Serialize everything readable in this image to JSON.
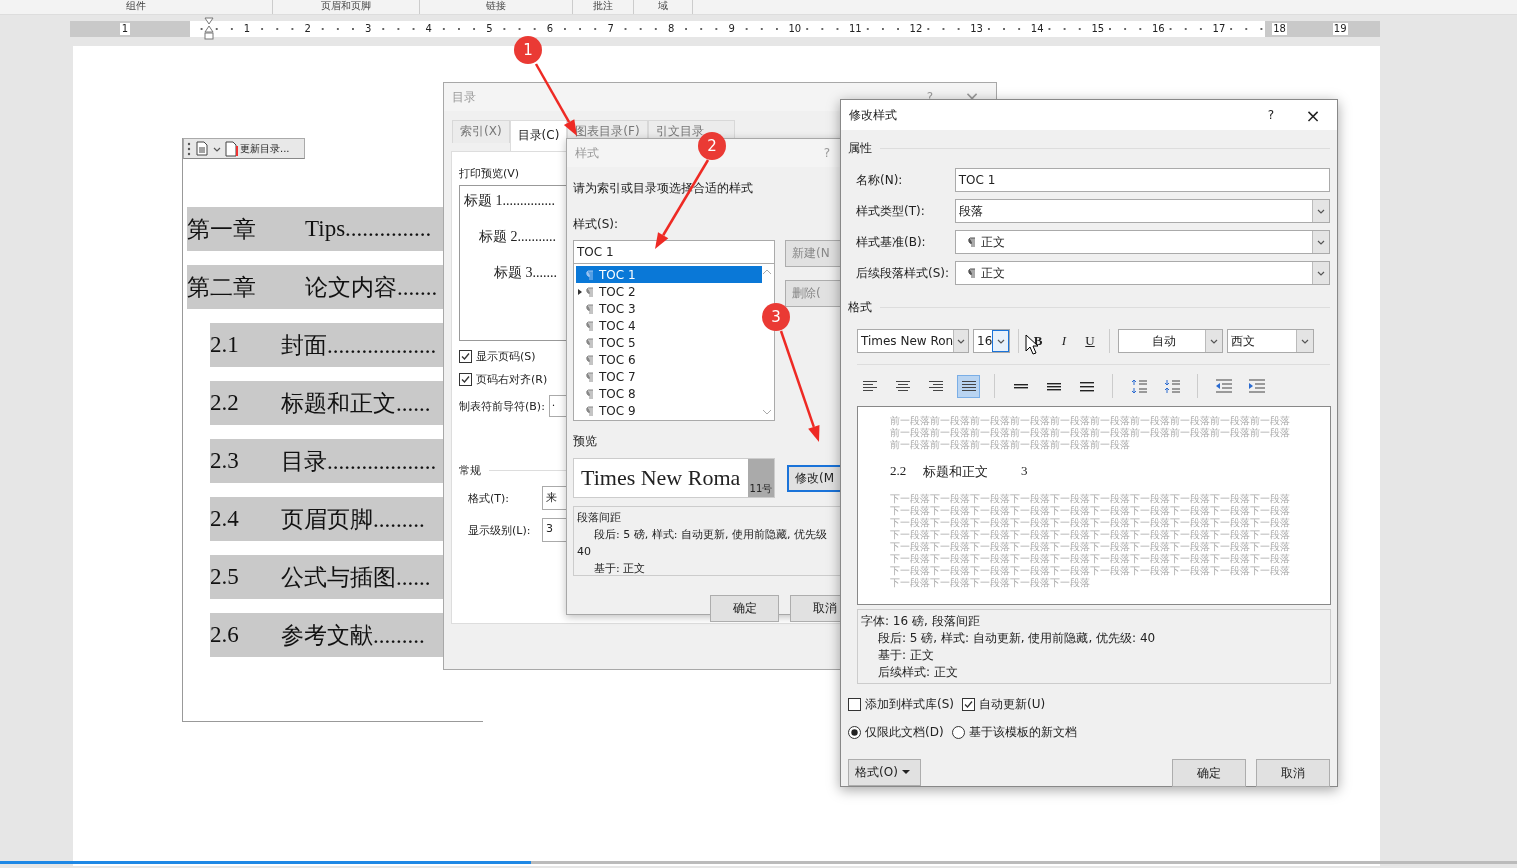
{
  "ribbon_groups": [
    "组件",
    "页眉和页脚",
    "链接",
    "批注",
    "域"
  ],
  "ruler": {
    "left_numbers": [
      "1"
    ],
    "numbers": [
      "1",
      "2",
      "3",
      "4",
      "5",
      "6",
      "7",
      "8",
      "9",
      "10",
      "11",
      "12",
      "13",
      "14",
      "15",
      "16",
      "17",
      "18",
      "19"
    ]
  },
  "toc_toolbar": {
    "label": "更新目录..."
  },
  "document_toc": [
    {
      "number": "第一章",
      "title": "Tips",
      "leader": "..............."
    },
    {
      "number": "第二章",
      "title": "论文内容",
      "leader": ".......",
      "children": [
        {
          "number": "2.1",
          "title": "封面",
          "leader": "..................."
        },
        {
          "number": "2.2",
          "title": "标题和正文",
          "leader": "......"
        },
        {
          "number": "2.3",
          "title": "目录",
          "leader": "..................."
        },
        {
          "number": "2.4",
          "title": "页眉页脚",
          "leader": "........."
        },
        {
          "number": "2.5",
          "title": "公式与插图",
          "leader": "......"
        },
        {
          "number": "2.6",
          "title": "参考文献",
          "leader": "........."
        }
      ]
    }
  ],
  "toc_dialog": {
    "title": "目录",
    "help": "?",
    "close": "×",
    "tabs": [
      {
        "label": "索引(X)",
        "selected": false
      },
      {
        "label": "目录(C)",
        "selected": true
      },
      {
        "label": "图表目录(F)",
        "selected": false
      },
      {
        "label": "引文目录",
        "selected": false
      }
    ],
    "print_preview_label": "打印预览(V)",
    "preview_entries": [
      {
        "text": "标题 1",
        "leader": "...............",
        "children": [
          {
            "text": "标题 2",
            "leader": "...........",
            "children": [
              {
                "text": "标题 3",
                "leader": "......."
              }
            ]
          }
        ]
      }
    ],
    "checkboxes": [
      {
        "label": "显示页码(S)",
        "checked": true
      },
      {
        "label": "页码右对齐(R)",
        "checked": true
      }
    ],
    "leader_label": "制表符前导符(B):",
    "leader_value": ".",
    "general_label": "常规",
    "format_label": "格式(T):",
    "format_value": "来",
    "levels_label": "显示级别(L):",
    "levels_value": "3"
  },
  "style_dialog": {
    "title": "样式",
    "help": "?",
    "instruction": "请为索引或目录项选择合适的样式",
    "style_label": "样式(S):",
    "style_value": "TOC 1",
    "styles": [
      {
        "name": "TOC 1",
        "selected": true,
        "expandable": false
      },
      {
        "name": "TOC 2",
        "selected": false,
        "expandable": true
      },
      {
        "name": "TOC 3",
        "selected": false,
        "expandable": false
      },
      {
        "name": "TOC 4",
        "selected": false,
        "expandable": false
      },
      {
        "name": "TOC 5",
        "selected": false,
        "expandable": false
      },
      {
        "name": "TOC 6",
        "selected": false,
        "expandable": false
      },
      {
        "name": "TOC 7",
        "selected": false,
        "expandable": false
      },
      {
        "name": "TOC 8",
        "selected": false,
        "expandable": false
      },
      {
        "name": "TOC 9",
        "selected": false,
        "expandable": false
      }
    ],
    "side_buttons": [
      "新建(N",
      "删除("
    ],
    "modify_button": "修改(M",
    "preview_label": "预览",
    "preview_text": "Times New Roma",
    "preview_size": "11号",
    "description": [
      {
        "text": "段落间距",
        "indent": false
      },
      {
        "text": "段后: 5 磅, 样式: 自动更新, 使用前隐藏, 优先级",
        "indent": true
      },
      {
        "text": "40",
        "indent": false
      },
      {
        "text": "基于: 正文",
        "indent": true
      }
    ],
    "ok": "确定",
    "cancel": "取消"
  },
  "modify_dialog": {
    "title": "修改样式",
    "help": "?",
    "close": "×",
    "properties_label": "属性",
    "fields": [
      {
        "label": "名称(N):",
        "value": "TOC 1",
        "kind": "text"
      },
      {
        "label": "样式类型(T):",
        "value": "段落",
        "kind": "select"
      },
      {
        "label": "样式基准(B):",
        "value": "正文",
        "kind": "style"
      },
      {
        "label": "后续段落样式(S):",
        "value": "正文",
        "kind": "style"
      }
    ],
    "format_label": "格式",
    "font": "Times New Ron",
    "size": "16",
    "text_buttons": [
      {
        "label": "B",
        "kind": "bold"
      },
      {
        "label": "I",
        "kind": "italic"
      },
      {
        "label": "U",
        "kind": "underline"
      }
    ],
    "font_color": "自动",
    "script": "西文",
    "align_buttons": [
      {
        "kind": "left",
        "selected": false
      },
      {
        "kind": "center",
        "selected": false
      },
      {
        "kind": "right",
        "selected": false
      },
      {
        "kind": "justify",
        "selected": true
      }
    ],
    "spacing_buttons": [
      {
        "kind": "single"
      },
      {
        "kind": "onehalf"
      },
      {
        "kind": "double"
      }
    ],
    "para_buttons": [
      {
        "kind": "increase"
      },
      {
        "kind": "decrease"
      }
    ],
    "indent_buttons": [
      {
        "kind": "outdent"
      },
      {
        "kind": "indent"
      }
    ],
    "preview": {
      "before": "前一段落前一段落前一段落前一段落前一段落前一段落前一段落前一段落前一段落前一段落前一段落前一段落前一段落前一段落前一段落前一段落前一段落前一段落前一段落前一段落前一段落前一段落前一段落前一段落前一段落前一段落",
      "heading_number": "2.2",
      "heading_title": "标题和正文",
      "heading_page": "3",
      "after": "下一段落下一段落下一段落下一段落下一段落下一段落下一段落下一段落下一段落下一段落下一段落下一段落下一段落下一段落下一段落下一段落下一段落下一段落下一段落下一段落下一段落下一段落下一段落下一段落下一段落下一段落下一段落下一段落下一段落下一段落下一段落下一段落下一段落下一段落下一段落下一段落下一段落下一段落下一段落下一段落下一段落下一段落下一段落下一段落下一段落下一段落下一段落下一段落下一段落下一段落下一段落下一段落下一段落下一段落下一段落下一段落下一段落下一段落下一段落下一段落下一段落下一段落下一段落下一段落下一段落下一段落下一段落下一段落下一段落下一段落下一段落下一段落下一段落下一段落下一段落"
    },
    "description": [
      {
        "text": "字体: 16 磅, 段落间距",
        "indent": false
      },
      {
        "text": "段后: 5 磅, 样式: 自动更新, 使用前隐藏, 优先级: 40",
        "indent": true
      },
      {
        "text": "基于: 正文",
        "indent": true
      },
      {
        "text": "后续样式: 正文",
        "indent": true
      }
    ],
    "checkboxes": [
      {
        "label": "添加到样式库(S)",
        "checked": false
      },
      {
        "label": "自动更新(U)",
        "checked": true
      }
    ],
    "radios": [
      {
        "label": "仅限此文档(D)",
        "selected": true
      },
      {
        "label": "基于该模板的新文档",
        "selected": false
      }
    ],
    "format_button": "格式(O)",
    "ok": "确定",
    "cancel": "取消"
  },
  "annotations": [
    {
      "label": "1"
    },
    {
      "label": "2"
    },
    {
      "label": "3"
    }
  ],
  "video_progress": {
    "level": 0.35
  }
}
